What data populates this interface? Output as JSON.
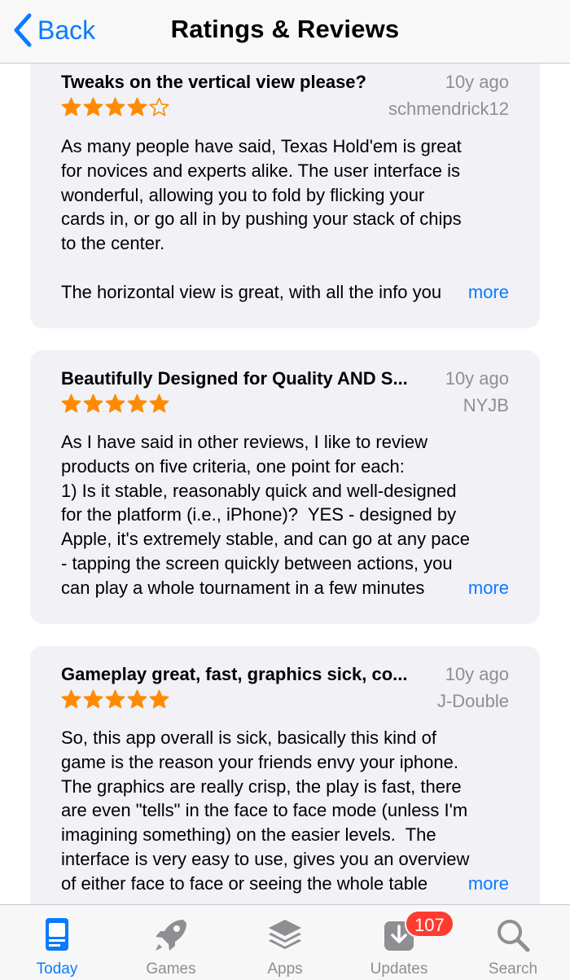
{
  "nav": {
    "back_label": "Back",
    "title": "Ratings & Reviews"
  },
  "colors": {
    "accent": "#0a7aff",
    "star": "#ff8a00",
    "badge": "#ff3b30",
    "card_bg": "#f1f1f6",
    "meta_text": "#8e8e93"
  },
  "reviews": [
    {
      "title": "Tweaks on the vertical view please?",
      "date": "10y ago",
      "author": "schmendrick12",
      "rating": 4,
      "max_rating": 5,
      "body": "As many people have said, Texas Hold'em is great\nfor novices and experts alike. The user interface is\nwonderful, allowing you to fold by flicking your\ncards in, or go all in by pushing your stack of chips\nto the center.\n\nThe horizontal view is great, with all the info you",
      "more_label": "more"
    },
    {
      "title": "Beautifully Designed for Quality AND S...",
      "date": "10y ago",
      "author": "NYJB",
      "rating": 5,
      "max_rating": 5,
      "body": "As I have said in other reviews, I like to review\nproducts on five criteria, one point for each:\n1) Is it stable, reasonably quick and well-designed\nfor the platform (i.e., iPhone)?  YES - designed by\nApple, it's extremely stable, and can go at any pace\n- tapping the screen quickly between actions, you\ncan play a whole tournament in a few minutes",
      "more_label": "more"
    },
    {
      "title": "Gameplay great, fast, graphics sick, co...",
      "date": "10y ago",
      "author": "J-Double",
      "rating": 5,
      "max_rating": 5,
      "body": "So, this app overall is sick, basically this kind of\ngame is the reason your friends envy your iphone.\nThe graphics are really crisp, the play is fast, there\nare even \"tells\" in the face to face mode (unless I'm\nimagining something) on the easier levels.  The\ninterface is very easy to use, gives you an overview\nof either face to face or seeing the whole table",
      "more_label": "more"
    }
  ],
  "tabbar": {
    "tabs": [
      {
        "label": "Today",
        "icon": "today-icon",
        "active": true
      },
      {
        "label": "Games",
        "icon": "rocket-icon",
        "active": false
      },
      {
        "label": "Apps",
        "icon": "layers-icon",
        "active": false
      },
      {
        "label": "Updates",
        "icon": "download-icon",
        "active": false
      },
      {
        "label": "Search",
        "icon": "search-icon",
        "active": false
      }
    ],
    "updates_badge": "107"
  }
}
